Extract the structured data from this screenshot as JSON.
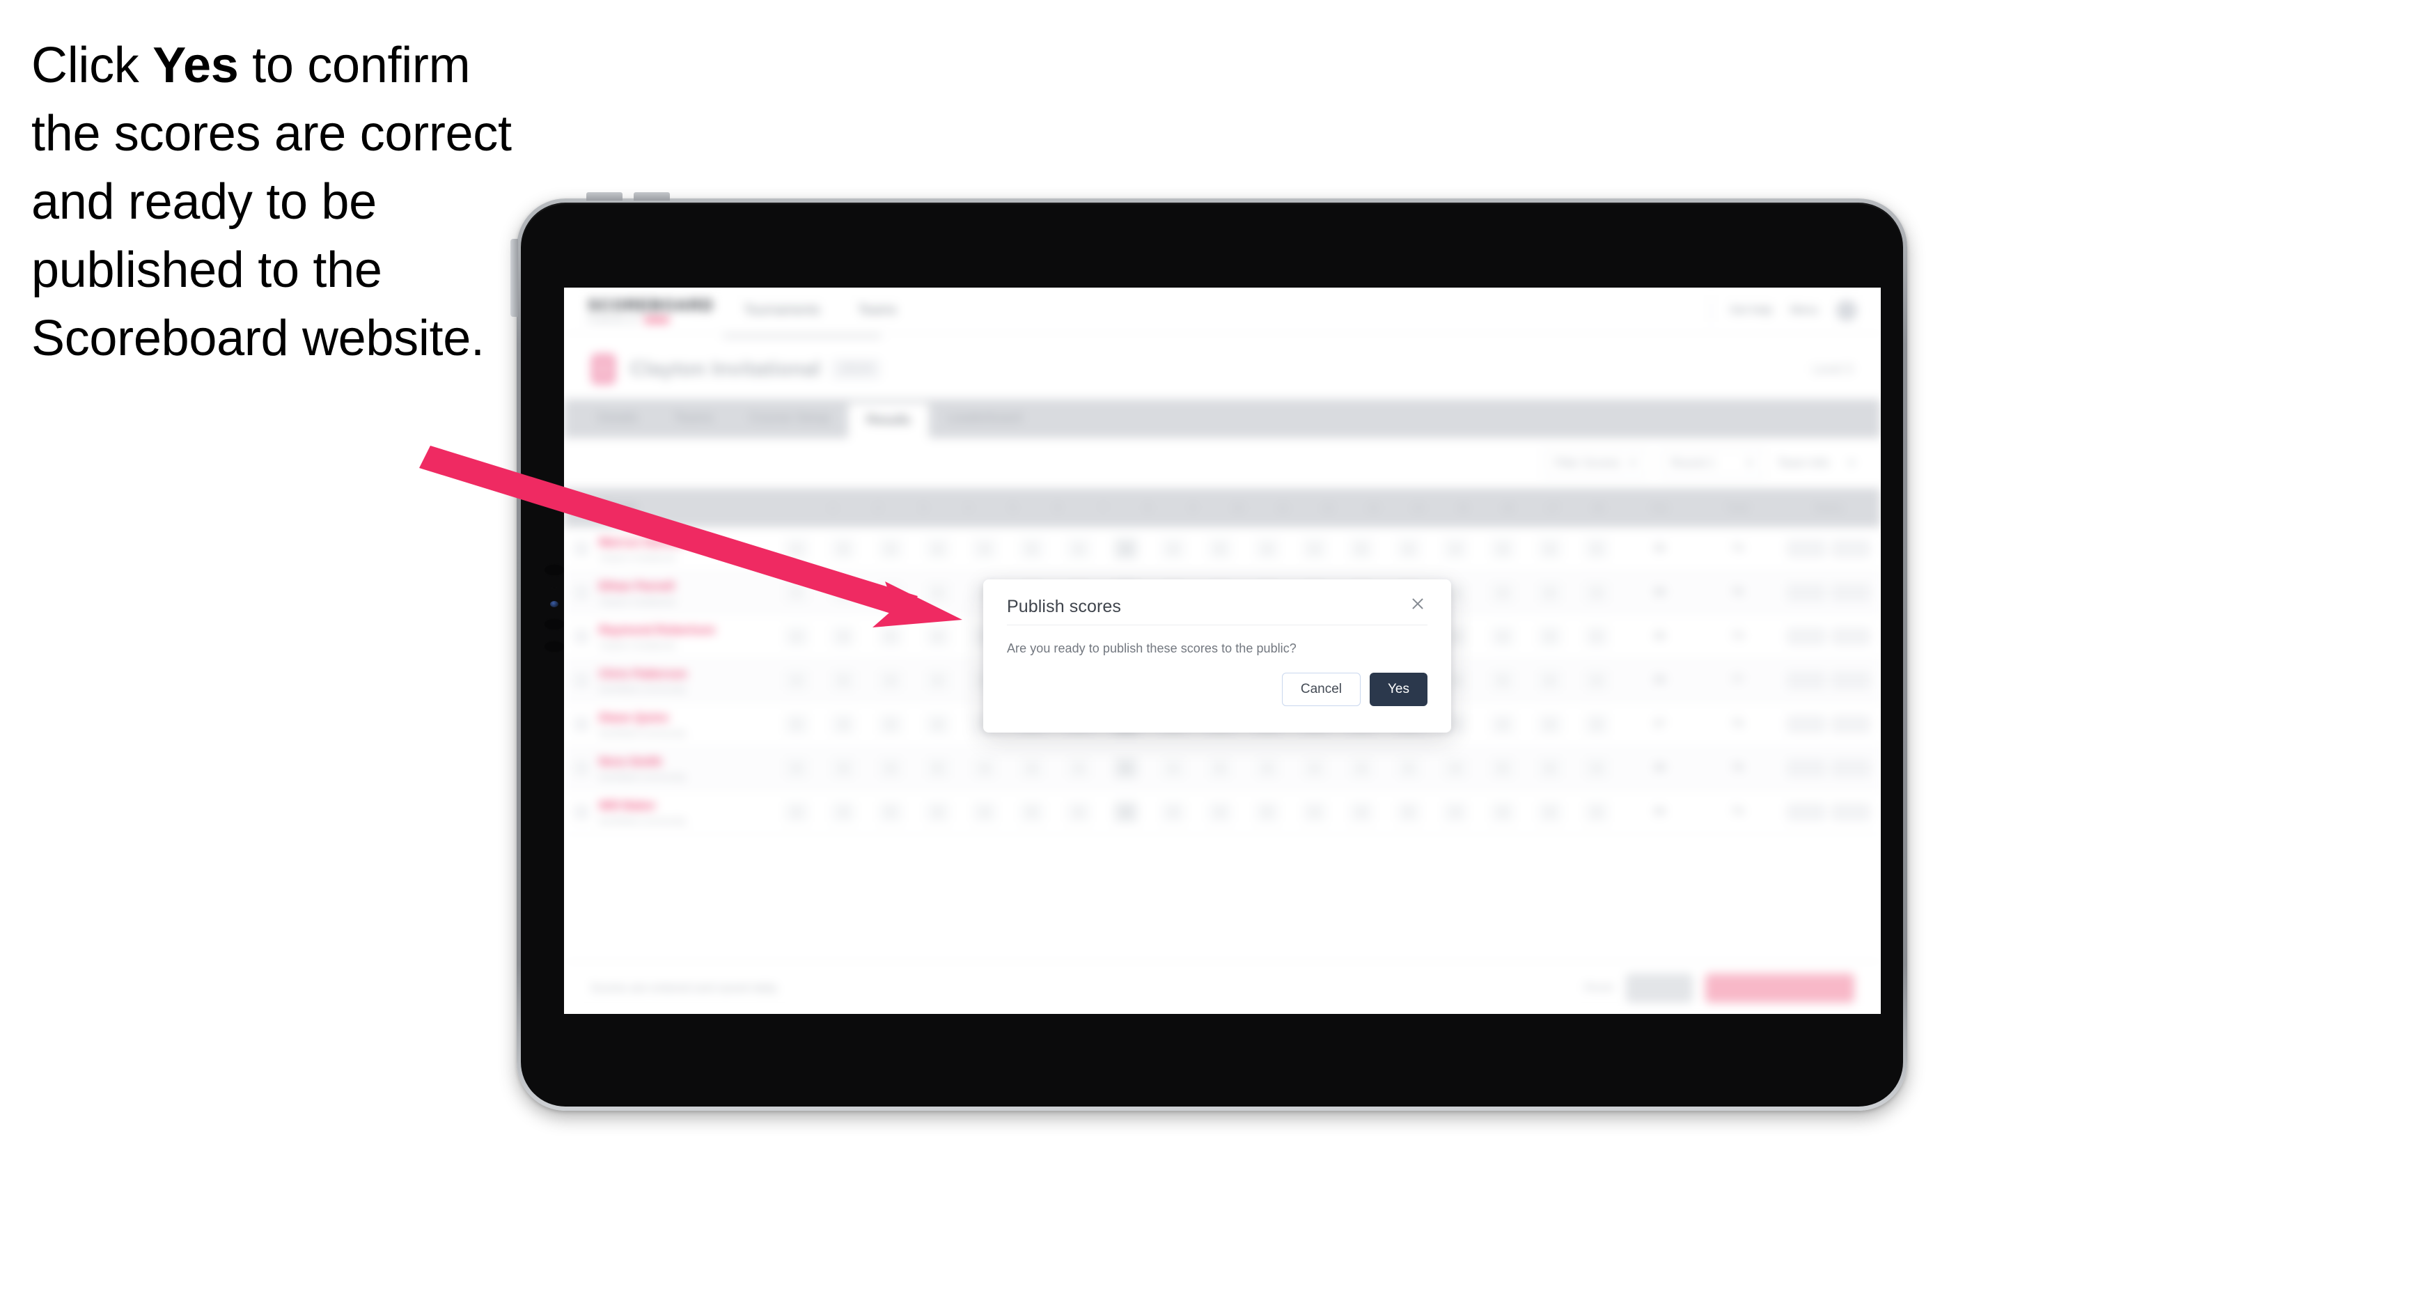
{
  "caption": {
    "prefix": "Click ",
    "emphasis": "Yes",
    "suffix": " to confirm the scores are correct and ready to be published to the Scoreboard website."
  },
  "colors": {
    "arrow": "#ef2a62",
    "accent_pink": "#ec2f62",
    "primary_button": "#2b384c",
    "device_body": "#0b0b0c",
    "device_frame": "#8e9196"
  },
  "device": {
    "type": "tablet",
    "buttons": [
      "volume-up",
      "volume-down",
      "power"
    ]
  },
  "modal": {
    "title": "Publish scores",
    "message": "Are you ready to publish these scores to the public?",
    "cancel_label": "Cancel",
    "confirm_label": "Yes",
    "close_icon": "close-icon"
  },
  "app": {
    "brand": {
      "word": "SCOREBOARD",
      "sub": "POWERED BY"
    },
    "nav_links": [
      "Tournaments",
      "Teams"
    ],
    "nav_right": {
      "help_label": "Get help",
      "user_label": "Menu"
    },
    "tournament": {
      "name": "Clayton Invitational",
      "chip": "2024",
      "right_label": "Level 3"
    },
    "tabs": [
      {
        "label": "Details",
        "active": false
      },
      {
        "label": "Teams",
        "active": false
      },
      {
        "label": "Course Setup",
        "active": false
      },
      {
        "label": "Results",
        "active": true
      },
      {
        "label": "Leaderboard",
        "active": false
      }
    ],
    "filters": {
      "pills": [
        "Filter Scores",
        "Round 1"
      ],
      "plain": "Team Info"
    },
    "table": {
      "columns": [
        "Player",
        "1",
        "2",
        "3",
        "4",
        "5",
        "6",
        "7",
        "8",
        "9",
        "10",
        "11",
        "12",
        "13",
        "14",
        "15",
        "16",
        "17",
        "18",
        "Out",
        "Total",
        "Status"
      ],
      "rows": [
        {
          "name": "Marcus Daniels",
          "team": "Clayton Invitational",
          "scores": [
            "4",
            "5",
            "3",
            "4",
            "4",
            "5",
            "4",
            "3",
            "4",
            "5",
            "4",
            "3",
            "5",
            "4",
            "4",
            "3",
            "4",
            "5"
          ],
          "out": "36",
          "total": "74",
          "status": [
            "HCP",
            "NET"
          ]
        },
        {
          "name": "Ethan Parnell",
          "team": "Clayton Invitational",
          "scores": [
            "5",
            "4",
            "4",
            "3",
            "5",
            "4",
            "4",
            "4",
            "3",
            "4",
            "5",
            "4",
            "4",
            "3",
            "5",
            "4",
            "4",
            "4"
          ],
          "out": "38",
          "total": "76",
          "status": [
            "HCP",
            "NET"
          ]
        },
        {
          "name": "Raymond Robertson",
          "team": "Clayton Invitational",
          "scores": [
            "4",
            "4",
            "5",
            "4",
            "3",
            "4",
            "5",
            "4",
            "4",
            "3",
            "4",
            "4",
            "5",
            "4",
            "4",
            "4",
            "3",
            "5"
          ],
          "out": "36",
          "total": "73",
          "status": [
            "HCP",
            "NET"
          ]
        },
        {
          "name": "Chris Patterson",
          "team": "Northfield Community",
          "scores": [
            "4",
            "5",
            "4",
            "4",
            "4",
            "3",
            "5",
            "6",
            "4",
            "4",
            "5",
            "4",
            "3",
            "4",
            "4",
            "5",
            "4",
            "4"
          ],
          "out": "39",
          "total": "77",
          "status": [
            "HCP",
            "NET"
          ]
        },
        {
          "name": "Diane Quinn",
          "team": "Northfield Community",
          "scores": [
            "5",
            "4",
            "3",
            "4",
            "5",
            "4",
            "4",
            "5",
            "4",
            "4",
            "3",
            "5",
            "4",
            "4",
            "5",
            "4",
            "4",
            "3"
          ],
          "out": "37",
          "total": "75",
          "status": [
            "HCP",
            "NET"
          ]
        },
        {
          "name": "Nora Smith",
          "team": "Northfield Community",
          "scores": [
            "4",
            "4",
            "4",
            "5",
            "4",
            "4",
            "3",
            "5",
            "4",
            "5",
            "4",
            "4",
            "4",
            "3",
            "4",
            "5",
            "4",
            "4"
          ],
          "out": "38",
          "total": "76",
          "status": [
            "HCP",
            "NET"
          ]
        },
        {
          "name": "Will Baker",
          "team": "Northfield Community",
          "scores": [
            "4",
            "3",
            "5",
            "4",
            "4",
            "5",
            "4",
            "4",
            "4",
            "4",
            "5",
            "3",
            "4",
            "5",
            "4",
            "4",
            "4",
            "4"
          ],
          "out": "36",
          "total": "74",
          "status": [
            "HCP",
            "NET"
          ]
        }
      ]
    },
    "footer": {
      "note": "Scores are entered and saved daily.",
      "link_label": "Reset",
      "secondary_button": "Save",
      "primary_button": "Publish scores to public"
    }
  }
}
